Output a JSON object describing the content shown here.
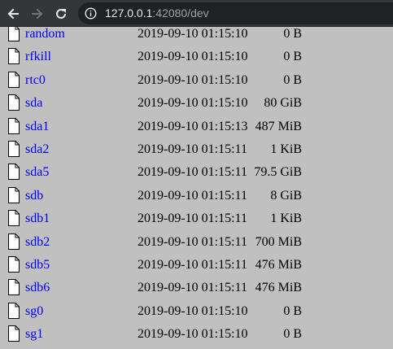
{
  "browser": {
    "url_host": "127.0.0.1",
    "url_rest": ":42080/dev"
  },
  "files": [
    {
      "name": "random",
      "date": "2019-09-10 01:15:10",
      "size": "0 B"
    },
    {
      "name": "rfkill",
      "date": "2019-09-10 01:15:10",
      "size": "0 B"
    },
    {
      "name": "rtc0",
      "date": "2019-09-10 01:15:10",
      "size": "0 B"
    },
    {
      "name": "sda",
      "date": "2019-09-10 01:15:10",
      "size": "80 GiB"
    },
    {
      "name": "sda1",
      "date": "2019-09-10 01:15:13",
      "size": "487 MiB"
    },
    {
      "name": "sda2",
      "date": "2019-09-10 01:15:11",
      "size": "1 KiB"
    },
    {
      "name": "sda5",
      "date": "2019-09-10 01:15:11",
      "size": "79.5 GiB"
    },
    {
      "name": "sdb",
      "date": "2019-09-10 01:15:11",
      "size": "8 GiB"
    },
    {
      "name": "sdb1",
      "date": "2019-09-10 01:15:11",
      "size": "1 KiB"
    },
    {
      "name": "sdb2",
      "date": "2019-09-10 01:15:11",
      "size": "700 MiB"
    },
    {
      "name": "sdb5",
      "date": "2019-09-10 01:15:11",
      "size": "476 MiB"
    },
    {
      "name": "sdb6",
      "date": "2019-09-10 01:15:11",
      "size": "476 MiB"
    },
    {
      "name": "sg0",
      "date": "2019-09-10 01:15:10",
      "size": "0 B"
    },
    {
      "name": "sg1",
      "date": "2019-09-10 01:15:10",
      "size": "0 B"
    }
  ],
  "colors": {
    "toolbar": "#35363a",
    "omnibox": "#202124",
    "page_background": "#c0c0c0",
    "link": "#0000ee"
  },
  "icons": {
    "back": "arrow-left-icon",
    "forward": "arrow-right-icon",
    "reload": "reload-icon",
    "site_info": "info-icon",
    "file": "file-icon"
  }
}
